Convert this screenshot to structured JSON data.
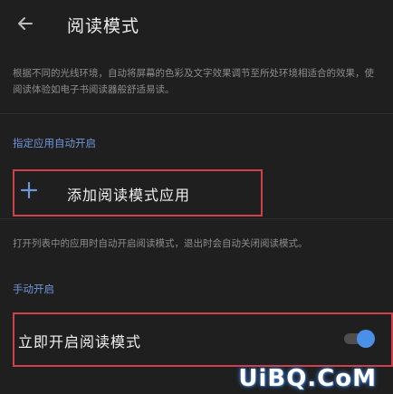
{
  "header": {
    "back_icon": "arrow-left-icon",
    "title": "阅读模式"
  },
  "description": "根据不同的光线环境，自动将屏幕的色彩及文字效果调节至所处环境相适合的效果，使阅读体验如电子书阅读器般舒适易读。",
  "auto_section": {
    "header": "指定应用自动开启",
    "add_icon": "plus-icon",
    "add_label": "添加阅读模式应用",
    "hint": "打开列表中的应用时自动开启阅读模式，退出时会自动关闭阅读模式。"
  },
  "manual_section": {
    "header": "手动开启",
    "toggle_label": "立即开启阅读模式",
    "toggle_on": true
  },
  "watermark": "UiBQ.CoM",
  "colors": {
    "background": "#1f1f1f",
    "accent": "#4a90e8",
    "section_header": "#6f95d8",
    "highlight_box": "#d0404a"
  }
}
